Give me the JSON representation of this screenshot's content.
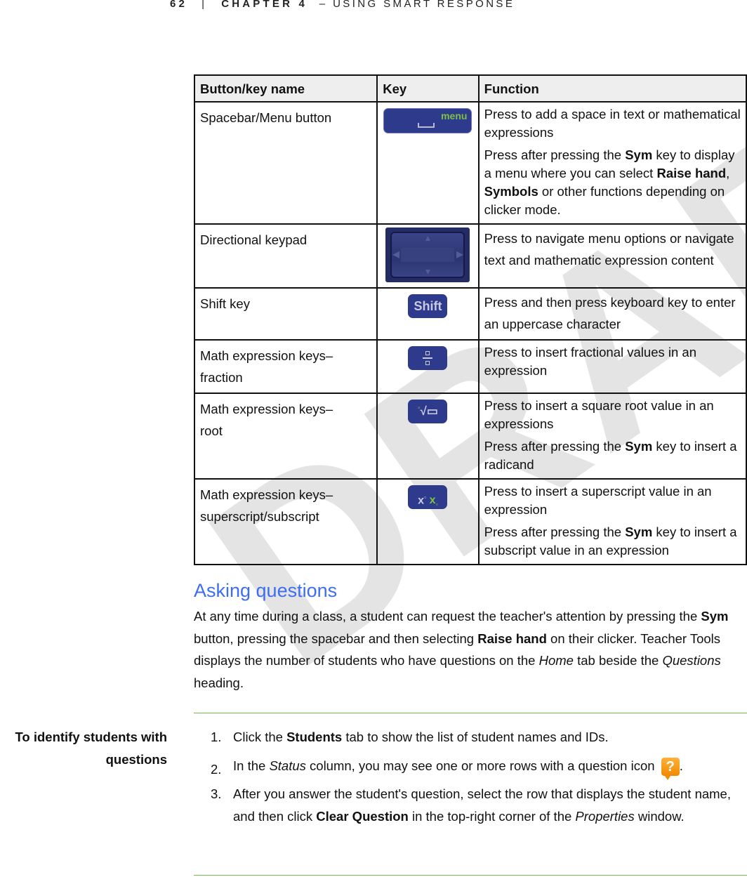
{
  "running_head": {
    "page_number": "62",
    "separator": "|",
    "chapter": "CHAPTER 4",
    "title": "– USING SMART RESPONSE"
  },
  "watermark": "DRAFT",
  "key_table": {
    "headers": [
      "Button/key name",
      "Key",
      "Function"
    ],
    "rows": [
      {
        "name": "Spacebar/Menu button",
        "key_icon": "spacebar-menu-key-icon",
        "key_label": "menu",
        "function": [
          [
            {
              "t": "Press to add a space in text or mathematical expressions"
            }
          ],
          [
            {
              "t": "Press after pressing the "
            },
            {
              "t": "Sym",
              "b": true
            },
            {
              "t": " key to display a menu where you can select "
            },
            {
              "t": "Raise hand",
              "b": true
            },
            {
              "t": ", "
            },
            {
              "t": "Symbols",
              "b": true
            },
            {
              "t": " or other functions depending on clicker mode."
            }
          ]
        ]
      },
      {
        "name": "Directional keypad",
        "key_icon": "directional-keypad-icon",
        "function": [
          [
            {
              "t": "Press to navigate menu options or navigate text and mathematic expression content"
            }
          ]
        ]
      },
      {
        "name": "Shift key",
        "key_icon": "shift-key-icon",
        "key_label": "Shift",
        "function": [
          [
            {
              "t": "Press and then press keyboard key to enter an uppercase character"
            }
          ]
        ]
      },
      {
        "name": "Math expression keys–fraction",
        "key_icon": "fraction-key-icon",
        "function": [
          [
            {
              "t": "Press to insert fractional values in an expression"
            }
          ]
        ]
      },
      {
        "name": "Math expression keys–root",
        "key_icon": "root-key-icon",
        "function": [
          [
            {
              "t": "Press to insert a square root value in an expressions"
            }
          ],
          [
            {
              "t": "Press after pressing the "
            },
            {
              "t": "Sym",
              "b": true
            },
            {
              "t": " key to insert a radicand"
            }
          ]
        ]
      },
      {
        "name": "Math expression keys–superscript/subscript",
        "key_icon": "superscript-subscript-key-icon",
        "function": [
          [
            {
              "t": "Press to insert a superscript value in an expression"
            }
          ],
          [
            {
              "t": "Press after pressing the "
            },
            {
              "t": "Sym",
              "b": true
            },
            {
              "t": " key to insert a subscript value in an expression"
            }
          ]
        ]
      }
    ]
  },
  "section": {
    "heading": "Asking questions",
    "intro": [
      {
        "t": "At any time during a class, a student can request the teacher's attention by pressing the "
      },
      {
        "t": "Sym",
        "b": true
      },
      {
        "t": " button, pressing the spacebar and then selecting "
      },
      {
        "t": "Raise hand",
        "b": true
      },
      {
        "t": " on their clicker. Teacher Tools displays the number of students who have questions on the "
      },
      {
        "t": "Home",
        "i": true
      },
      {
        "t": " tab beside the "
      },
      {
        "t": "Questions",
        "i": true
      },
      {
        "t": " heading."
      }
    ]
  },
  "procedure": {
    "title": "To identify students with questions",
    "steps": [
      {
        "num": "1.",
        "parts": [
          {
            "t": "Click the "
          },
          {
            "t": "Students",
            "b": true
          },
          {
            "t": " tab to show the list of student names and IDs."
          }
        ]
      },
      {
        "num": "2.",
        "parts": [
          {
            "t": "In the "
          },
          {
            "t": "Status",
            "i": true
          },
          {
            "t": " column, you may see one or more rows with a question icon "
          },
          {
            "icon": "question-icon",
            "t": "?"
          },
          {
            "t": "."
          }
        ]
      },
      {
        "num": "3.",
        "parts": [
          {
            "t": "After you answer the student's question, select the row that displays the student name, and then click "
          },
          {
            "t": "Clear Question",
            "b": true
          },
          {
            "t": " in the top-right corner of the "
          },
          {
            "t": "Properties",
            "i": true
          },
          {
            "t": " window."
          }
        ]
      }
    ]
  },
  "colors": {
    "heading_blue": "#3d6ef0",
    "rule_green": "#6fbf4a",
    "key_navy": "#2e3a8c",
    "key_green": "#7dc242",
    "question_orange": "#f18a00",
    "table_header_bg": "#eeeeee"
  }
}
